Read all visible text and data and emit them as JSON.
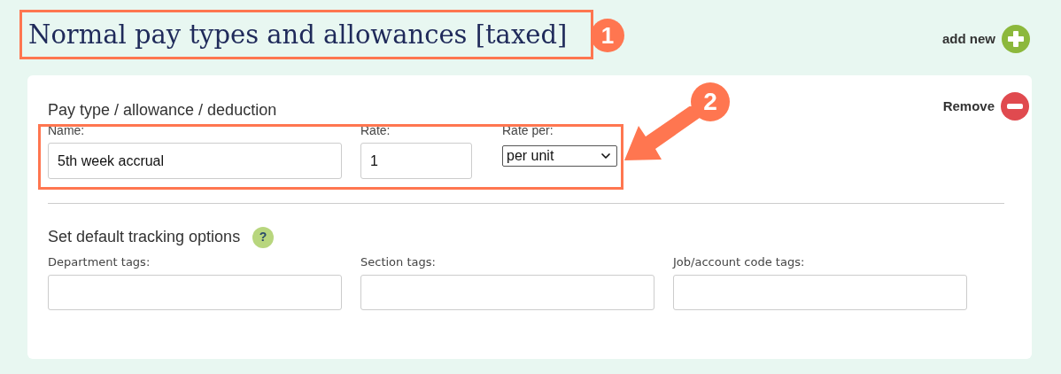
{
  "page": {
    "title": "Normal pay types and allowances [taxed]",
    "add_new": "add new"
  },
  "card": {
    "section_title": "Pay type / allowance / deduction",
    "remove": "Remove",
    "fields": [
      {
        "kind": "text",
        "label": "Name:",
        "value": "5th week accrual"
      },
      {
        "kind": "text",
        "label": "Rate:",
        "value": "1"
      },
      {
        "kind": "select",
        "label": "Rate per:",
        "value": "per unit"
      }
    ],
    "tracking": {
      "title": "Set default tracking options",
      "help_icon": "?",
      "fields": [
        {
          "label": "Department tags:"
        },
        {
          "label": "Section tags:"
        },
        {
          "label": "Job/account code tags:"
        }
      ]
    }
  },
  "annotations": [
    {
      "number": "1"
    },
    {
      "number": "2"
    }
  ]
}
